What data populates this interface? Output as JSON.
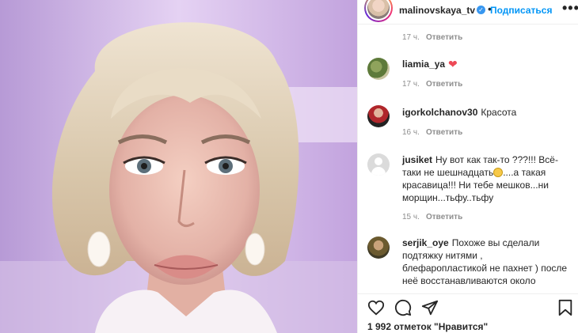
{
  "post": {
    "username": "malinovskaya_tv",
    "follow_label": "Подписаться",
    "header_separator": "•",
    "more_label": "•••"
  },
  "comments": [
    {
      "username": "",
      "text": "",
      "time": "17 ч.",
      "reply": "Ответить"
    },
    {
      "username": "liamia_ya",
      "text": "",
      "emoji_icon": "red-heart-icon",
      "time": "17 ч.",
      "reply": "Ответить"
    },
    {
      "username": "igorkolchanov30",
      "text": "Красота",
      "time": "16 ч.",
      "reply": "Ответить"
    },
    {
      "username": "jusiket",
      "text_part1": "Ну вот как так-то ???!!! Всё-таки не шешнадцать",
      "emoji_icon": "grinning-face-icon",
      "text_part2": "....а такая красавица!!! Ни тебе мешков...ни морщин...тьфу..тьфу",
      "time": "15 ч.",
      "reply": "Ответить"
    },
    {
      "username": "serjik_oye",
      "text": "Похоже вы сделали подтяжку нитями , блефаропластикой не пахнет ) после неё восстанавливаются около",
      "time": "",
      "reply": ""
    }
  ],
  "actions": {
    "like_icon": "heart-outline-icon",
    "comment_icon": "comment-icon",
    "share_icon": "paper-plane-icon",
    "save_icon": "bookmark-icon"
  },
  "likes_text": "1 992 отметок \"Нравится\"",
  "colors": {
    "link_blue": "#0095f6",
    "verified_blue": "#3897f0",
    "heart_red": "#ed4956",
    "meta_gray": "#8e8e8e",
    "text": "#262626"
  }
}
